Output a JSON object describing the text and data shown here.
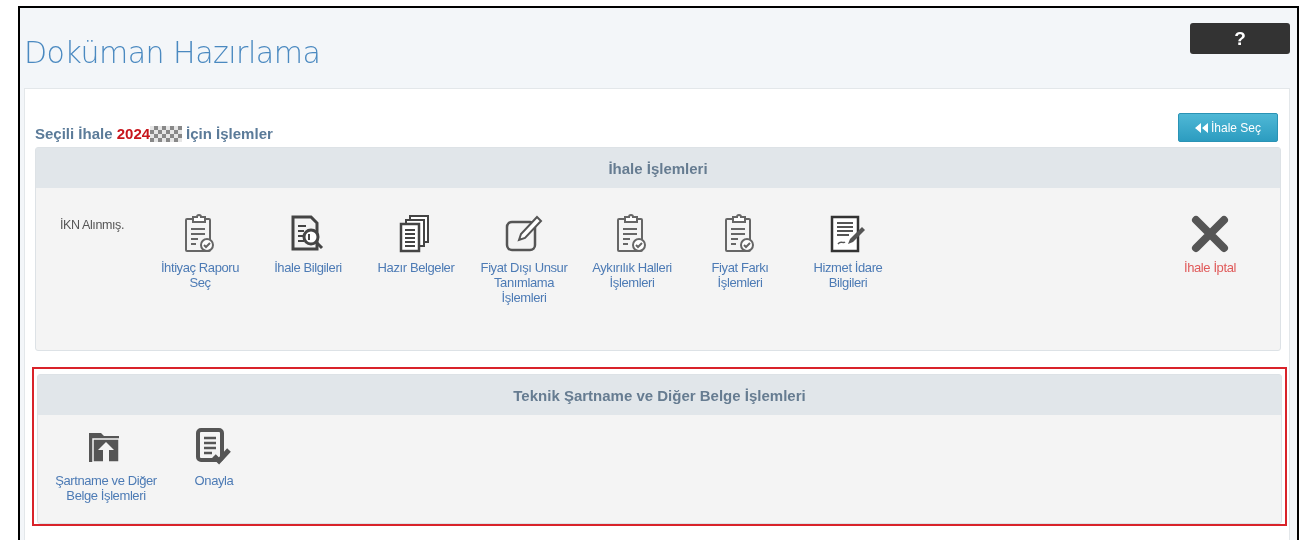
{
  "page": {
    "title": "Doküman Hazırlama",
    "help_button": "?"
  },
  "selection": {
    "prefix": "Seçili İhale",
    "ikn": "2024",
    "redacted": true,
    "suffix": "İçin İşlemler",
    "back_button": "İhale Seç"
  },
  "sections": [
    {
      "title": "İhale İşlemleri",
      "highlighted": false,
      "items": [
        {
          "kind": "status",
          "label": "İKN Alınmış."
        },
        {
          "kind": "action",
          "label": "İhtiyaç Raporu Seç"
        },
        {
          "kind": "action",
          "label": "İhale Bilgileri"
        },
        {
          "kind": "action",
          "label": "Hazır Belgeler"
        },
        {
          "kind": "action",
          "label": "Fiyat Dışı Unsur Tanımlama İşlemleri"
        },
        {
          "kind": "action",
          "label": "Aykırılık Halleri İşlemleri"
        },
        {
          "kind": "action",
          "label": "Fiyat Farkı İşlemleri"
        },
        {
          "kind": "action",
          "label": "Hizmet İdare Bilgileri"
        },
        {
          "kind": "danger",
          "label": "İhale İptal"
        }
      ]
    },
    {
      "title": "Teknik Şartname ve Diğer Belge İşlemleri",
      "highlighted": true,
      "items": [
        {
          "kind": "action",
          "label": "Şartname ve Diğer Belge İşlemleri"
        },
        {
          "kind": "action",
          "label": "Onayla"
        }
      ]
    }
  ]
}
